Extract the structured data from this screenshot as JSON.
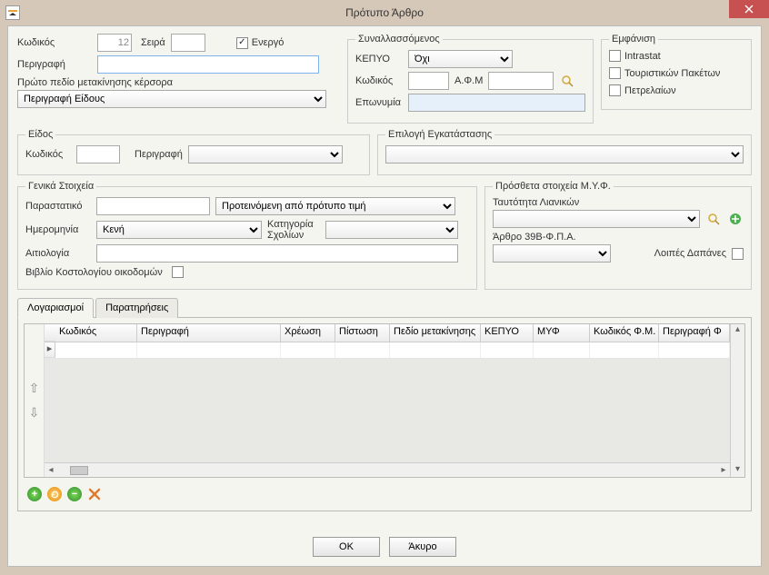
{
  "title": "Πρότυπο Άρθρο",
  "top": {
    "code_label": "Κωδικός",
    "code_value": "12",
    "series_label": "Σειρά",
    "series_value": "",
    "active_label": "Ενεργό",
    "desc_label": "Περιγραφή",
    "desc_value": "",
    "cursor_label": "Πρώτο πεδίο μετακίνησης κέρσορα",
    "cursor_value": "Περιγραφή Είδους"
  },
  "partner": {
    "legend": "Συναλλασσόμενος",
    "kepyo_label": "ΚΕΠΥΟ",
    "kepyo_value": "Όχι",
    "code_label": "Κωδικός",
    "afm_label": "Α.Φ.Μ",
    "name_label": "Επωνυμία"
  },
  "display": {
    "legend": "Εμφάνιση",
    "intrastat": "Intrastat",
    "tour": "Τουριστικών Πακέτων",
    "petrol": "Πετρελαίων"
  },
  "kind": {
    "legend": "Είδος",
    "code_label": "Κωδικός",
    "desc_label": "Περιγραφή"
  },
  "install": {
    "legend": "Επιλογή Εγκατάστασης"
  },
  "general": {
    "legend": "Γενικά Στοιχεία",
    "doc_label": "Παραστατικό",
    "price_value": "Προτεινόμενη από πρότυπο τιμή",
    "date_label": "Ημερομηνία",
    "date_value": "Κενή",
    "comment_cat_label": "Κατηγορία Σχολίων",
    "justif_label": "Αιτιολογία",
    "building_label": "Βιβλίο Κοστολογίου οικοδομών"
  },
  "myf": {
    "legend": "Πρόσθετα στοιχεία Μ.Υ.Φ.",
    "retail_label": "Ταυτότητα Λιανικών",
    "article_label": "Άρθρο 39Β-Φ.Π.Α.",
    "other_label": "Λοιπές Δαπάνες"
  },
  "tabs": {
    "accounts": "Λογαριασμοί",
    "notes": "Παρατηρήσεις"
  },
  "grid": {
    "cols": [
      "Κωδικός",
      "Περιγραφή",
      "Χρέωση",
      "Πίστωση",
      "Πεδίο μετακίνησης",
      "ΚΕΠΥΟ",
      "ΜΥΦ",
      "Κωδικός Φ.Μ.",
      "Περιγραφή Φ"
    ]
  },
  "buttons": {
    "ok": "OK",
    "cancel": "Άκυρο"
  }
}
